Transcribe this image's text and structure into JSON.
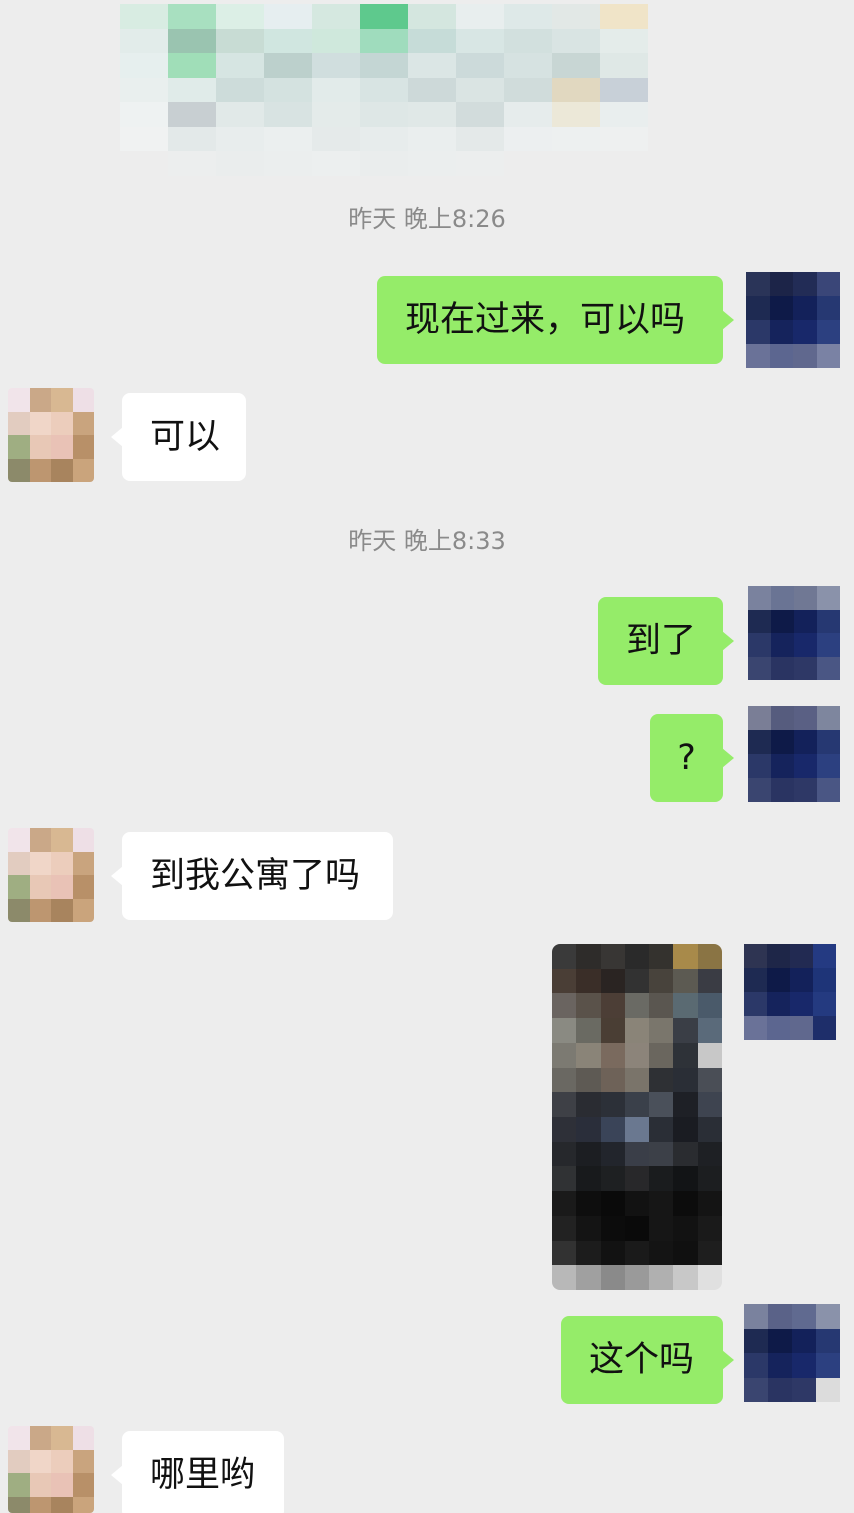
{
  "timestamps": [
    "昨天 晚上8:26",
    "昨天 晚上8:33"
  ],
  "messages": [
    {
      "side": "right",
      "text": "现在过来，可以吗"
    },
    {
      "side": "left",
      "text": "可以"
    },
    {
      "side": "right",
      "text": "到了"
    },
    {
      "side": "right",
      "text": "?"
    },
    {
      "side": "left",
      "text": "到我公寓了吗"
    },
    {
      "side": "right",
      "text": "这个吗"
    },
    {
      "side": "left",
      "text": "哪里哟"
    }
  ],
  "icons": {
    "contact_avatar": "contact-avatar-photo",
    "self_avatar": "self-avatar-pixelated",
    "map_preview": "location-map-preview",
    "photo_message": "photo-message-pixelated"
  },
  "colors": {
    "background": "#ededed",
    "outgoing_bubble": "#95ec69",
    "incoming_bubble": "#ffffff",
    "timestamp_text": "#8a8a8a"
  }
}
